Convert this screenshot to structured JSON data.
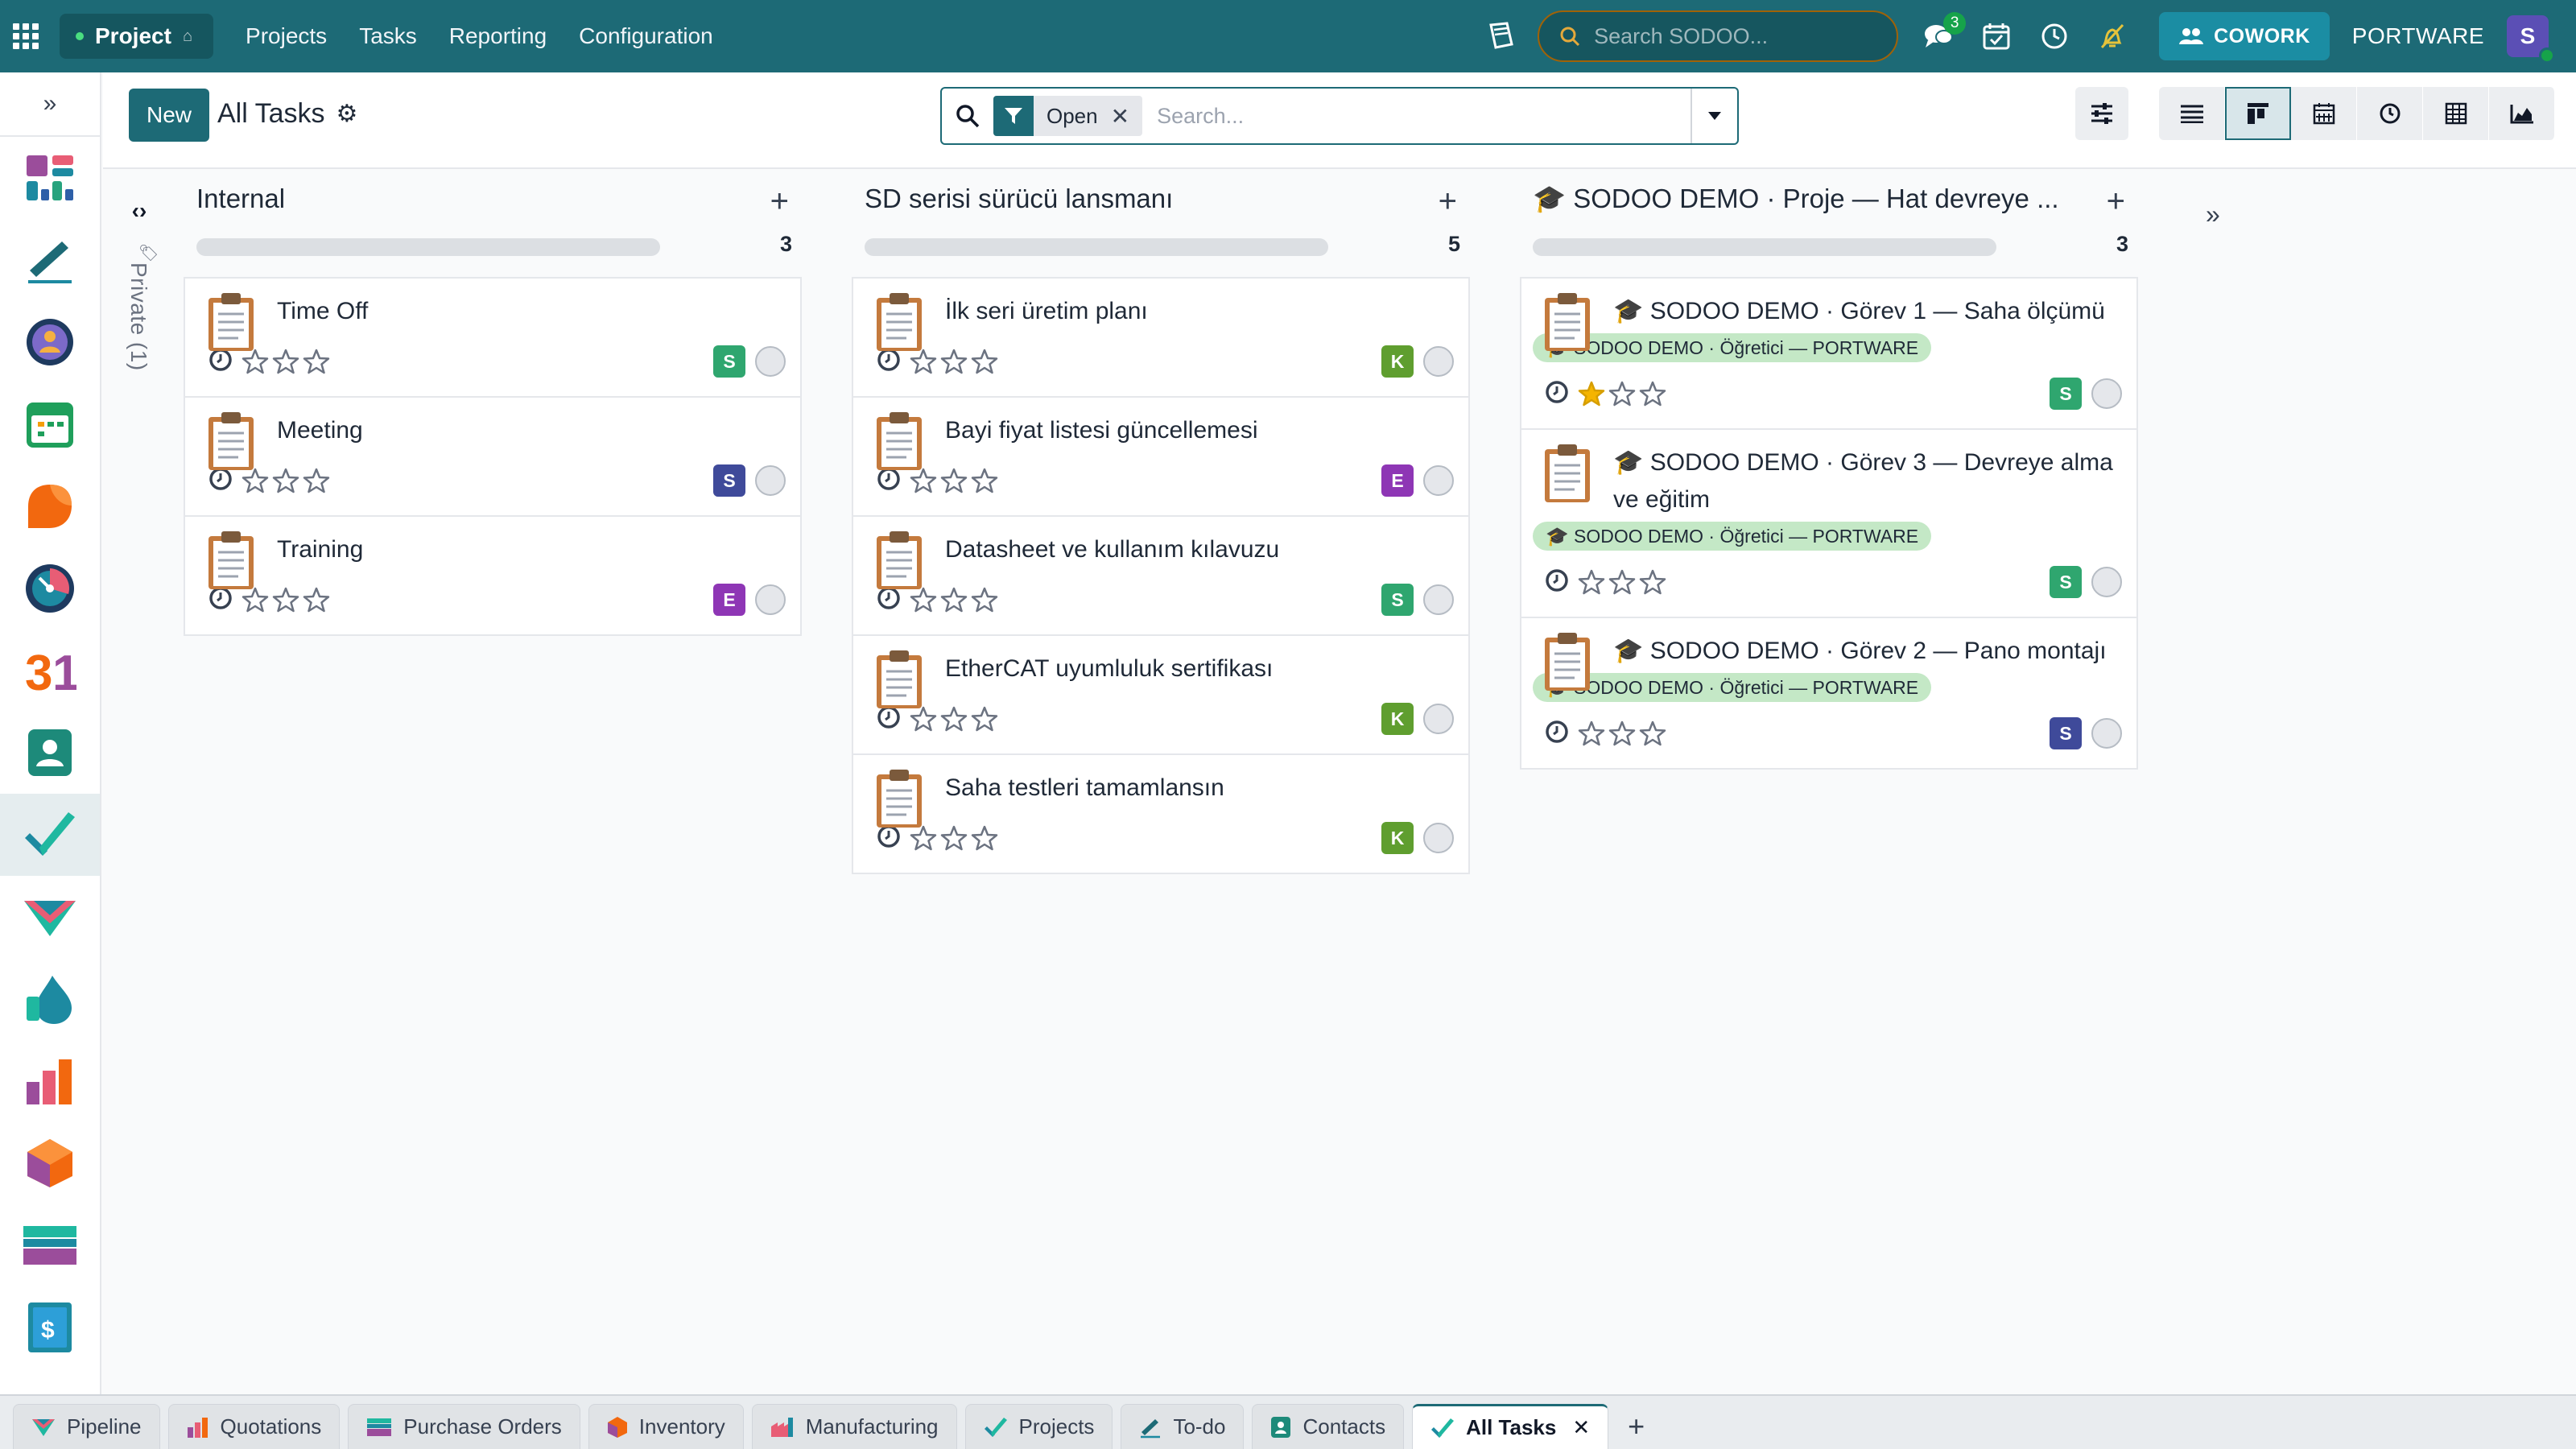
{
  "app": {
    "name": "Project",
    "menu": [
      "Projects",
      "Tasks",
      "Reporting",
      "Configuration"
    ],
    "search_placeholder": "Search SODOO...",
    "messages_badge": "3",
    "cowork_label": "COWORK",
    "company": "PORTWARE",
    "user_initial": "S"
  },
  "control": {
    "new_label": "New",
    "title": "All Tasks",
    "facet_label": "Open",
    "search_placeholder": "Search..."
  },
  "folded_column": {
    "label": "Private (1)"
  },
  "columns": [
    {
      "title": "Internal",
      "count": "3",
      "cards": [
        {
          "title": "Time Off",
          "user": "S",
          "user_color": "#2fa66f",
          "stars": 0
        },
        {
          "title": "Meeting",
          "user": "S",
          "user_color": "#3f4a9a",
          "stars": 0
        },
        {
          "title": "Training",
          "user": "E",
          "user_color": "#8e36b5",
          "stars": 0
        }
      ]
    },
    {
      "title": "SD serisi sürücü lansmanı",
      "count": "5",
      "cards": [
        {
          "title": "İlk seri üretim planı",
          "user": "K",
          "user_color": "#5f9e2f",
          "stars": 0
        },
        {
          "title": "Bayi fiyat listesi güncellemesi",
          "user": "E",
          "user_color": "#8e36b5",
          "stars": 0
        },
        {
          "title": "Datasheet ve kullanım kılavuzu",
          "user": "S",
          "user_color": "#2fa66f",
          "stars": 0
        },
        {
          "title": "EtherCAT uyumluluk sertifikası",
          "user": "K",
          "user_color": "#5f9e2f",
          "stars": 0
        },
        {
          "title": "Saha testleri tamamlansın",
          "user": "K",
          "user_color": "#5f9e2f",
          "stars": 0
        }
      ]
    },
    {
      "title": "🎓 SODOO DEMO · Proje — Hat devreye ...",
      "count": "3",
      "cards": [
        {
          "title": "🎓 SODOO DEMO · Görev 1 — Saha ölçümü",
          "tag": "🎓 SODOO DEMO · Öğretici — PORTWARE",
          "user": "S",
          "user_color": "#2fa66f",
          "stars": 1
        },
        {
          "title": "🎓 SODOO DEMO · Görev 3 — Devreye alma ve eğitim",
          "tag": "🎓 SODOO DEMO · Öğretici — PORTWARE",
          "user": "S",
          "user_color": "#2fa66f",
          "stars": 0
        },
        {
          "title": "🎓 SODOO DEMO · Görev 2 — Pano montajı",
          "tag": "🎓 SODOO DEMO · Öğretici — PORTWARE",
          "user": "S",
          "user_color": "#3f4a9a",
          "stars": 0
        }
      ]
    }
  ],
  "dock_icons": [
    "dashboard-icon",
    "sign-icon",
    "discuss-icon",
    "calendar-icon",
    "crm-icon",
    "timer-icon",
    "calendar-31-icon",
    "contacts-icon",
    "project-icon",
    "sales-icon",
    "helpdesk-icon",
    "reporting-icon",
    "inventory-icon",
    "purchase-icon",
    "invoicing-icon"
  ],
  "bottom_tabs": [
    {
      "label": "Pipeline",
      "icon": "pipeline-icon"
    },
    {
      "label": "Quotations",
      "icon": "quotations-icon"
    },
    {
      "label": "Purchase Orders",
      "icon": "purchase-icon"
    },
    {
      "label": "Inventory",
      "icon": "inventory-icon"
    },
    {
      "label": "Manufacturing",
      "icon": "manufacturing-icon"
    },
    {
      "label": "Projects",
      "icon": "project-icon"
    },
    {
      "label": "To-do",
      "icon": "todo-icon"
    },
    {
      "label": "Contacts",
      "icon": "contacts-icon"
    },
    {
      "label": "All Tasks",
      "icon": "project-icon",
      "active": true
    }
  ]
}
